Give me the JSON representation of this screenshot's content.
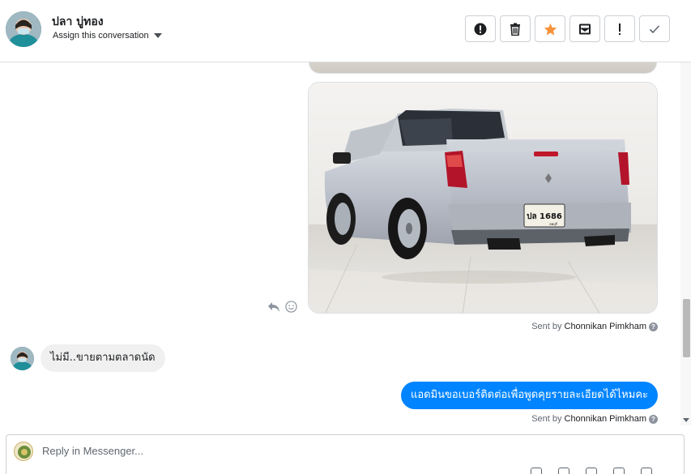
{
  "header": {
    "contact_name": "ปลา บู่ทอง",
    "assign_label": "Assign this conversation",
    "actions": [
      {
        "id": "spam",
        "icon": "alert-circle-icon"
      },
      {
        "id": "delete",
        "icon": "trash-icon"
      },
      {
        "id": "star",
        "icon": "star-icon",
        "color": "#f7923b"
      },
      {
        "id": "mark-unread",
        "icon": "envelope-icon"
      },
      {
        "id": "important",
        "icon": "exclamation-icon"
      },
      {
        "id": "done",
        "icon": "check-icon"
      }
    ]
  },
  "thread": {
    "image_plate_text": "ปล 1686",
    "image_plate_sub": "ลพบุรี",
    "sent_by_prefix": "Sent by",
    "agent_name": "Chonnikan Pimkham",
    "incoming_message": "ไม่มี..ขายตามตลาดนัด",
    "outgoing_message": "แอดมินขอเบอร์ติดต่อเพื่อพูดคุยรายละเอียดได้ไหมคะ",
    "help_glyph": "?"
  },
  "reply": {
    "placeholder": "Reply in Messenger..."
  },
  "colors": {
    "outgoing_bubble": "#0084ff",
    "incoming_bubble": "#f0f0f0",
    "star": "#f7923b"
  }
}
